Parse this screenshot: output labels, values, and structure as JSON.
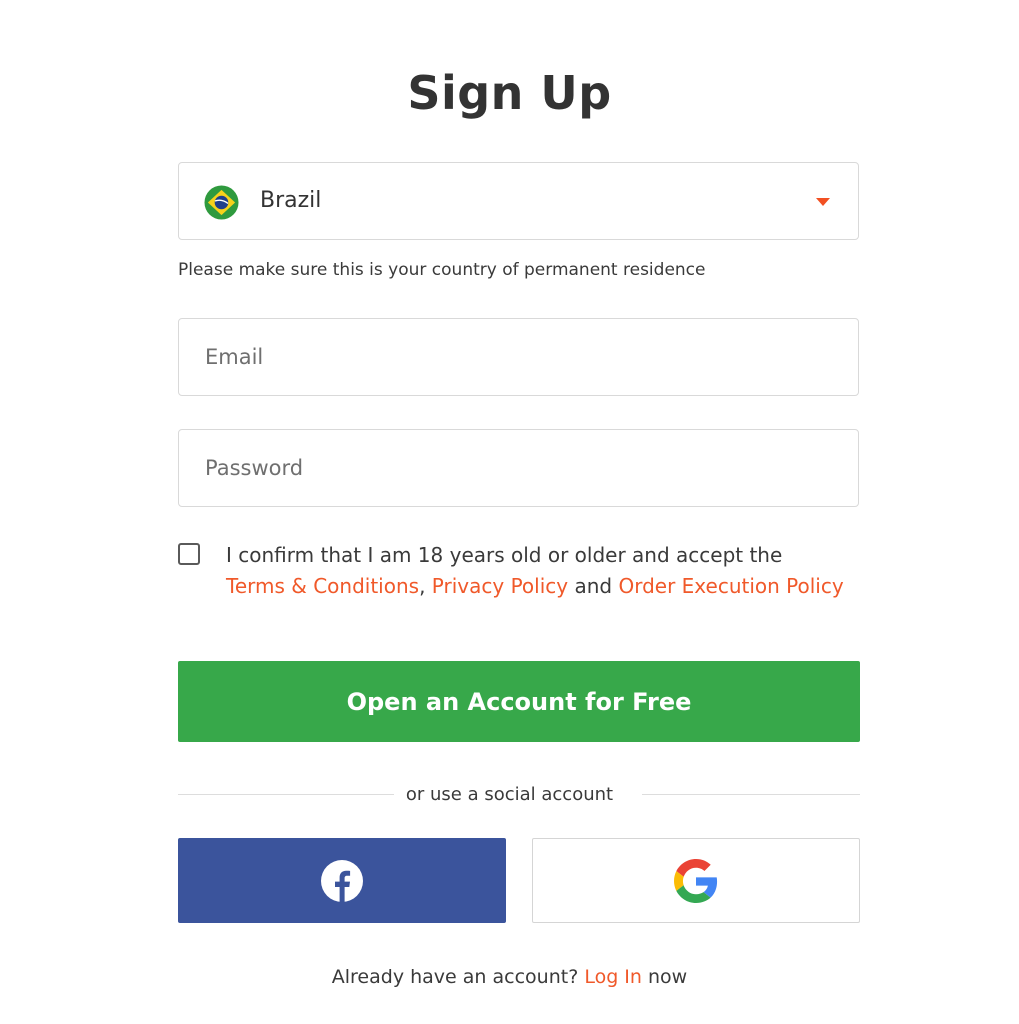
{
  "form": {
    "title": "Sign Up",
    "country": {
      "selected": "Brazil",
      "flag_icon": "brazil-flag-icon",
      "caret_icon": "caret-down-icon",
      "hint": "Please make sure this is your country of permanent residence"
    },
    "email": {
      "placeholder": "Email",
      "value": ""
    },
    "password": {
      "placeholder": "Password",
      "value": ""
    },
    "consent": {
      "checked": false,
      "text_before": "I confirm that I am 18 years old or older and accept the",
      "terms_link": "Terms & Conditions",
      "separator": ",",
      "privacy_link": "Privacy Policy",
      "and_text": "and",
      "execution_link": "Order Execution Policy"
    },
    "submit_label": "Open an Account for Free",
    "divider_text": "or use a social account",
    "social": {
      "facebook_icon": "facebook-icon",
      "google_icon": "google-icon"
    },
    "login": {
      "prompt": "Already have an account?",
      "link": "Log In",
      "suffix": "now"
    }
  },
  "colors": {
    "accent": "#f0592a",
    "primary_button": "#37a84a",
    "facebook": "#3b549c",
    "text": "#3a3a3a",
    "border": "#d9d9d9"
  }
}
